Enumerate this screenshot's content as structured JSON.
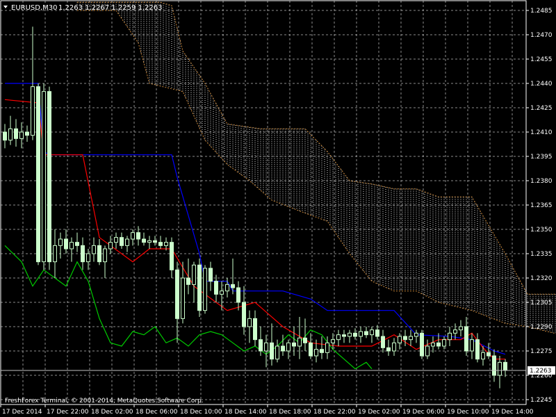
{
  "header": {
    "collapse_arrow": "triangle-down-icon",
    "symbol_timeframe": "EURUSD,M30",
    "ohlc": "1.2263 1.2267 1.2259 1.2263"
  },
  "footer": {
    "copyright": "FreshForex Terminal, © 2001-2014, MetaQuotes Software Corp."
  },
  "colors": {
    "background": "#000000",
    "grid": "#c8c8c8",
    "candle": "#ccffcc",
    "kijun": "#0000ff",
    "tenkan": "#ff0000",
    "chikou": "#00cc00",
    "kumo": "#ffffff",
    "kumo_edge": "#c8873a",
    "bid_line": "#c0c0c0"
  },
  "price_label": "1.2263",
  "chart_data": {
    "type": "candlestick",
    "title": "EURUSD,M30",
    "grid": true,
    "ylim": [
      1.2242,
      1.2491
    ],
    "y_ticks": [
      "1.2485",
      "1.2470",
      "1.2455",
      "1.2440",
      "1.2425",
      "1.2410",
      "1.2395",
      "1.2380",
      "1.2365",
      "1.2350",
      "1.2335",
      "1.2320",
      "1.2305",
      "1.2290",
      "1.2275",
      "1.2260",
      "1.2245"
    ],
    "x_ticks": [
      "17 Dec 2014",
      "17 Dec 22:00",
      "18 Dec 02:00",
      "18 Dec 06:00",
      "18 Dec 10:00",
      "18 Dec 14:00",
      "18 Dec 18:00",
      "18 Dec 22:00",
      "19 Dec 02:00",
      "19 Dec 06:00",
      "19 Dec 10:00",
      "19 Dec 14:00"
    ],
    "current_price": 1.2263,
    "candles": [
      [
        1.241,
        1.2415,
        1.24,
        1.2405
      ],
      [
        1.2405,
        1.242,
        1.2402,
        1.2412
      ],
      [
        1.2412,
        1.2418,
        1.2401,
        1.2406
      ],
      [
        1.2406,
        1.2416,
        1.24,
        1.241
      ],
      [
        1.241,
        1.2414,
        1.2404,
        1.2408
      ],
      [
        1.2408,
        1.2475,
        1.2405,
        1.2438
      ],
      [
        1.2438,
        1.244,
        1.2328,
        1.233
      ],
      [
        1.233,
        1.244,
        1.2325,
        1.2435
      ],
      [
        1.2435,
        1.2438,
        1.2325,
        1.233
      ],
      [
        1.233,
        1.235,
        1.232,
        1.234
      ],
      [
        1.234,
        1.2348,
        1.2332,
        1.2344
      ],
      [
        1.2344,
        1.235,
        1.2335,
        1.2338
      ],
      [
        1.2338,
        1.2345,
        1.233,
        1.2342
      ],
      [
        1.2342,
        1.2348,
        1.2336,
        1.234
      ],
      [
        1.234,
        1.2345,
        1.2325,
        1.233
      ],
      [
        1.233,
        1.2338,
        1.2325,
        1.2335
      ],
      [
        1.2335,
        1.2345,
        1.233,
        1.234
      ],
      [
        1.234,
        1.2344,
        1.2328,
        1.233
      ],
      [
        1.233,
        1.234,
        1.232,
        1.2338
      ],
      [
        1.2338,
        1.2346,
        1.2335,
        1.2342
      ],
      [
        1.2342,
        1.2348,
        1.2338,
        1.2345
      ],
      [
        1.2345,
        1.2348,
        1.2338,
        1.234
      ],
      [
        1.234,
        1.2346,
        1.2336,
        1.2344
      ],
      [
        1.2344,
        1.235,
        1.234,
        1.2348
      ],
      [
        1.2348,
        1.2352,
        1.234,
        1.2344
      ],
      [
        1.2344,
        1.2348,
        1.234,
        1.2342
      ],
      [
        1.2342,
        1.2346,
        1.2338,
        1.2343
      ],
      [
        1.2343,
        1.2346,
        1.234,
        1.2342
      ],
      [
        1.2342,
        1.2346,
        1.2338,
        1.234
      ],
      [
        1.234,
        1.2345,
        1.2337,
        1.2342
      ],
      [
        1.2342,
        1.2345,
        1.232,
        1.2325
      ],
      [
        1.2325,
        1.233,
        1.228,
        1.2295
      ],
      [
        1.2295,
        1.233,
        1.2292,
        1.232
      ],
      [
        1.232,
        1.2332,
        1.231,
        1.2316
      ],
      [
        1.2316,
        1.233,
        1.2305,
        1.2328
      ],
      [
        1.2328,
        1.2332,
        1.2296,
        1.23
      ],
      [
        1.23,
        1.2328,
        1.2298,
        1.2326
      ],
      [
        1.2326,
        1.233,
        1.2312,
        1.2318
      ],
      [
        1.2318,
        1.2322,
        1.2305,
        1.231
      ],
      [
        1.231,
        1.2318,
        1.23,
        1.2312
      ],
      [
        1.2312,
        1.232,
        1.2308,
        1.2316
      ],
      [
        1.2316,
        1.2332,
        1.231,
        1.2314
      ],
      [
        1.2314,
        1.2318,
        1.23,
        1.2305
      ],
      [
        1.2305,
        1.2315,
        1.2285,
        1.229
      ],
      [
        1.229,
        1.23,
        1.228,
        1.2295
      ],
      [
        1.2295,
        1.23,
        1.2278,
        1.2282
      ],
      [
        1.2282,
        1.229,
        1.2272,
        1.2275
      ],
      [
        1.2275,
        1.2285,
        1.2265,
        1.228
      ],
      [
        1.228,
        1.2292,
        1.2266,
        1.227
      ],
      [
        1.227,
        1.2282,
        1.2268,
        1.2278
      ],
      [
        1.2278,
        1.2285,
        1.2272,
        1.2275
      ],
      [
        1.2275,
        1.2282,
        1.227,
        1.228
      ],
      [
        1.228,
        1.229,
        1.2272,
        1.2278
      ],
      [
        1.2278,
        1.2296,
        1.227,
        1.2283
      ],
      [
        1.2283,
        1.2295,
        1.2275,
        1.228
      ],
      [
        1.228,
        1.2286,
        1.227,
        1.2272
      ],
      [
        1.2272,
        1.2282,
        1.2268,
        1.2276
      ],
      [
        1.2276,
        1.2284,
        1.227,
        1.2274
      ],
      [
        1.2274,
        1.2284,
        1.227,
        1.228
      ],
      [
        1.228,
        1.2286,
        1.2276,
        1.2282
      ],
      [
        1.2282,
        1.2288,
        1.2278,
        1.2285
      ],
      [
        1.2285,
        1.2288,
        1.228,
        1.2284
      ],
      [
        1.2284,
        1.2288,
        1.228,
        1.2286
      ],
      [
        1.2286,
        1.2289,
        1.2282,
        1.2284
      ],
      [
        1.2284,
        1.229,
        1.228,
        1.2287
      ],
      [
        1.2287,
        1.229,
        1.2283,
        1.2285
      ],
      [
        1.2285,
        1.229,
        1.228,
        1.2288
      ],
      [
        1.2288,
        1.2291,
        1.2282,
        1.2284
      ],
      [
        1.2284,
        1.2288,
        1.2274,
        1.2277
      ],
      [
        1.2277,
        1.2282,
        1.2272,
        1.2275
      ],
      [
        1.2275,
        1.2283,
        1.2272,
        1.228
      ],
      [
        1.228,
        1.2286,
        1.2276,
        1.2284
      ],
      [
        1.2284,
        1.2288,
        1.2278,
        1.2282
      ],
      [
        1.2282,
        1.2288,
        1.2278,
        1.2284
      ],
      [
        1.2284,
        1.2288,
        1.228,
        1.2286
      ],
      [
        1.2286,
        1.2288,
        1.227,
        1.2272
      ],
      [
        1.2272,
        1.2282,
        1.227,
        1.2278
      ],
      [
        1.2278,
        1.2284,
        1.2274,
        1.228
      ],
      [
        1.228,
        1.2286,
        1.2276,
        1.2278
      ],
      [
        1.2278,
        1.2284,
        1.2276,
        1.2282
      ],
      [
        1.2282,
        1.229,
        1.2278,
        1.2286
      ],
      [
        1.2286,
        1.2292,
        1.2282,
        1.2288
      ],
      [
        1.2288,
        1.2294,
        1.2284,
        1.229
      ],
      [
        1.229,
        1.2296,
        1.2272,
        1.2275
      ],
      [
        1.2275,
        1.2286,
        1.227,
        1.2282
      ],
      [
        1.2282,
        1.2286,
        1.2268,
        1.227
      ],
      [
        1.227,
        1.2278,
        1.2266,
        1.2274
      ],
      [
        1.2274,
        1.228,
        1.227,
        1.2272
      ],
      [
        1.2272,
        1.2276,
        1.2256,
        1.226
      ],
      [
        1.226,
        1.2272,
        1.2252,
        1.2268
      ],
      [
        1.2268,
        1.227,
        1.2259,
        1.2263
      ]
    ],
    "series": [
      {
        "name": "Kijun-sen",
        "points": [
          [
            0,
            1.244
          ],
          [
            6,
            1.244
          ],
          [
            7,
            1.2398
          ],
          [
            8,
            1.2396
          ],
          [
            30,
            1.2396
          ],
          [
            31,
            1.2382
          ],
          [
            35,
            1.2335
          ],
          [
            36,
            1.2318
          ],
          [
            40,
            1.2318
          ],
          [
            41,
            1.2312
          ],
          [
            50,
            1.2312
          ],
          [
            55,
            1.2307
          ],
          [
            58,
            1.23
          ],
          [
            70,
            1.23
          ],
          [
            74,
            1.2285
          ],
          [
            80,
            1.2284
          ],
          [
            84,
            1.2282
          ],
          [
            88,
            1.2275
          ],
          [
            90,
            1.2273
          ]
        ]
      },
      {
        "name": "Tenkan-sen",
        "points": [
          [
            0,
            1.243
          ],
          [
            6,
            1.2428
          ],
          [
            7,
            1.2396
          ],
          [
            14,
            1.2396
          ],
          [
            17,
            1.2345
          ],
          [
            23,
            1.233
          ],
          [
            26,
            1.2338
          ],
          [
            30,
            1.2338
          ],
          [
            34,
            1.2315
          ],
          [
            40,
            1.23
          ],
          [
            45,
            1.2305
          ],
          [
            50,
            1.229
          ],
          [
            55,
            1.228
          ],
          [
            60,
            1.2278
          ],
          [
            66,
            1.2278
          ],
          [
            70,
            1.2285
          ],
          [
            74,
            1.2276
          ],
          [
            78,
            1.2282
          ],
          [
            82,
            1.2282
          ],
          [
            84,
            1.2286
          ],
          [
            86,
            1.2277
          ],
          [
            88,
            1.227
          ],
          [
            90,
            1.227
          ]
        ]
      },
      {
        "name": "Chikou Span",
        "points": [
          [
            0,
            1.234
          ],
          [
            3,
            1.233
          ],
          [
            5,
            1.2315
          ],
          [
            7,
            1.2325
          ],
          [
            9,
            1.232
          ],
          [
            11,
            1.2315
          ],
          [
            13,
            1.233
          ],
          [
            15,
            1.2318
          ],
          [
            17,
            1.2295
          ],
          [
            19,
            1.228
          ],
          [
            21,
            1.2278
          ],
          [
            23,
            1.2287
          ],
          [
            25,
            1.2285
          ],
          [
            27,
            1.229
          ],
          [
            29,
            1.228
          ],
          [
            31,
            1.2283
          ],
          [
            33,
            1.2278
          ],
          [
            35,
            1.2285
          ],
          [
            37,
            1.2287
          ],
          [
            39,
            1.2285
          ],
          [
            41,
            1.228
          ],
          [
            43,
            1.2275
          ],
          [
            45,
            1.2278
          ],
          [
            47,
            1.2273
          ],
          [
            49,
            1.2278
          ],
          [
            51,
            1.2285
          ],
          [
            53,
            1.228
          ],
          [
            55,
            1.2288
          ],
          [
            57,
            1.2285
          ],
          [
            59,
            1.2276
          ],
          [
            61,
            1.227
          ],
          [
            63,
            1.2264
          ],
          [
            65,
            1.2268
          ],
          [
            66,
            1.2264
          ]
        ]
      },
      {
        "name": "Senkou Span A",
        "points": [
          [
            13,
            1.2485
          ],
          [
            20,
            1.2485
          ],
          [
            24,
            1.2465
          ],
          [
            26,
            1.244
          ],
          [
            32,
            1.2435
          ],
          [
            36,
            1.2405
          ],
          [
            40,
            1.239
          ],
          [
            44,
            1.238
          ],
          [
            48,
            1.2368
          ],
          [
            54,
            1.236
          ],
          [
            58,
            1.2355
          ],
          [
            62,
            1.2335
          ],
          [
            66,
            1.2318
          ],
          [
            70,
            1.2312
          ],
          [
            74,
            1.2312
          ],
          [
            78,
            1.2305
          ],
          [
            84,
            1.23
          ],
          [
            90,
            1.2292
          ],
          [
            94,
            1.229
          ],
          [
            100,
            1.2285
          ],
          [
            104,
            1.2278
          ]
        ]
      },
      {
        "name": "Senkou Span B",
        "points": [
          [
            13,
            1.249
          ],
          [
            28,
            1.249
          ],
          [
            30,
            1.2488
          ],
          [
            32,
            1.246
          ],
          [
            36,
            1.244
          ],
          [
            40,
            1.2415
          ],
          [
            46,
            1.2412
          ],
          [
            54,
            1.2412
          ],
          [
            58,
            1.2398
          ],
          [
            62,
            1.238
          ],
          [
            66,
            1.2378
          ],
          [
            70,
            1.2375
          ],
          [
            74,
            1.2375
          ],
          [
            78,
            1.237
          ],
          [
            84,
            1.237
          ],
          [
            90,
            1.2335
          ],
          [
            94,
            1.231
          ],
          [
            100,
            1.231
          ],
          [
            104,
            1.231
          ]
        ]
      }
    ]
  }
}
